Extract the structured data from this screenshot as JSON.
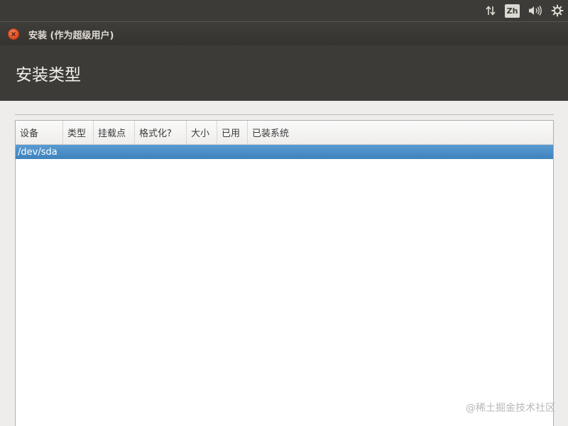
{
  "top_panel": {
    "keyboard_indicator": "Zh",
    "icons": [
      "network-transfer-icon",
      "volume-icon",
      "gear-icon"
    ]
  },
  "window": {
    "title": "安装 (作为超级用户)"
  },
  "header": {
    "title": "安装类型"
  },
  "table": {
    "columns": [
      "设备",
      "类型",
      "挂载点",
      "格式化?",
      "大小",
      "已用",
      "已装系统"
    ],
    "rows": [
      {
        "device": "/dev/sda",
        "type": "",
        "mount": "",
        "format": "",
        "size": "",
        "used": "",
        "system": ""
      }
    ],
    "selected_row": 0
  },
  "watermark": "@稀土掘金技术社区",
  "colors": {
    "panel": "#3c3b37",
    "close_button": "#dc4c1c",
    "selection": "#4a8bc6"
  }
}
